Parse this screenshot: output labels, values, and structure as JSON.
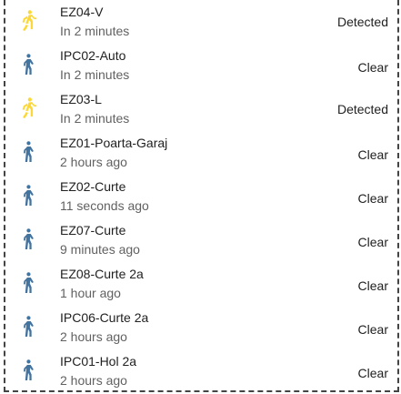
{
  "colors": {
    "detected_icon": "#FDD835",
    "clear_icon": "#44739E",
    "primary_text": "#212121",
    "secondary_text": "#616161"
  },
  "sensors": [
    {
      "name": "EZ04-V",
      "time": "In 2 minutes",
      "state": "Detected",
      "icon": "walking-person-icon"
    },
    {
      "name": "IPC02-Auto",
      "time": "In 2 minutes",
      "state": "Clear",
      "icon": "standing-person-icon"
    },
    {
      "name": "EZ03-L",
      "time": "In 2 minutes",
      "state": "Detected",
      "icon": "walking-person-icon"
    },
    {
      "name": "EZ01-Poarta-Garaj",
      "time": "2 hours ago",
      "state": "Clear",
      "icon": "standing-person-icon"
    },
    {
      "name": "EZ02-Curte",
      "time": "11 seconds ago",
      "state": "Clear",
      "icon": "standing-person-icon"
    },
    {
      "name": "EZ07-Curte",
      "time": "9 minutes ago",
      "state": "Clear",
      "icon": "standing-person-icon"
    },
    {
      "name": "EZ08-Curte 2a",
      "time": "1 hour ago",
      "state": "Clear",
      "icon": "standing-person-icon"
    },
    {
      "name": "IPC06-Curte 2a",
      "time": "2 hours ago",
      "state": "Clear",
      "icon": "standing-person-icon"
    },
    {
      "name": "IPC01-Hol 2a",
      "time": "2 hours ago",
      "state": "Clear",
      "icon": "standing-person-icon"
    }
  ]
}
